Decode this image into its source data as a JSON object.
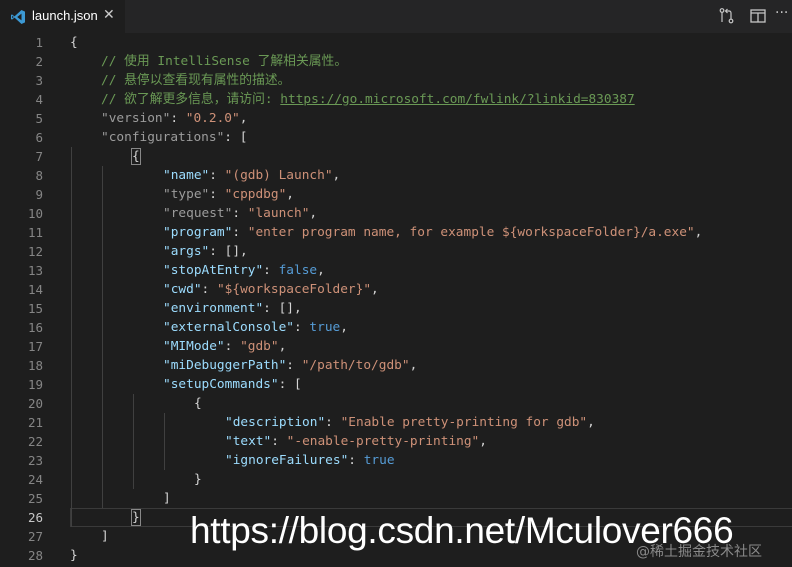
{
  "tab": {
    "label": "launch.json",
    "close_glyph": "✕"
  },
  "actions": [
    {
      "name": "open-changes-icon"
    },
    {
      "name": "split-editor-icon"
    },
    {
      "name": "more-actions-icon",
      "glyph": "···"
    }
  ],
  "current_line": 26,
  "lines": [
    {
      "n": "1",
      "ind": 0,
      "t": [
        [
          "p",
          "{"
        ]
      ]
    },
    {
      "n": "2",
      "ind": 1,
      "t": [
        [
          "c",
          "// 使用 IntelliSense 了解相关属性。"
        ]
      ]
    },
    {
      "n": "3",
      "ind": 1,
      "t": [
        [
          "c",
          "// 悬停以查看现有属性的描述。"
        ]
      ]
    },
    {
      "n": "4",
      "ind": 1,
      "t": [
        [
          "c",
          "// 欲了解更多信息，请访问: "
        ],
        [
          "u",
          "https://go.microsoft.com/fwlink/?linkid=830387"
        ]
      ]
    },
    {
      "n": "5",
      "ind": 1,
      "t": [
        [
          "kd",
          "\"version\""
        ],
        [
          "p",
          ": "
        ],
        [
          "s",
          "\"0.2.0\""
        ],
        [
          "p",
          ","
        ]
      ]
    },
    {
      "n": "6",
      "ind": 1,
      "t": [
        [
          "kd",
          "\"configurations\""
        ],
        [
          "p",
          ": ["
        ]
      ]
    },
    {
      "n": "7",
      "ind": 2,
      "t": [
        [
          "bx",
          "{"
        ]
      ]
    },
    {
      "n": "8",
      "ind": 3,
      "t": [
        [
          "k",
          "\"name\""
        ],
        [
          "p",
          ": "
        ],
        [
          "s",
          "\"(gdb) Launch\""
        ],
        [
          "p",
          ","
        ]
      ]
    },
    {
      "n": "9",
      "ind": 3,
      "t": [
        [
          "kd",
          "\"type\""
        ],
        [
          "p",
          ": "
        ],
        [
          "s",
          "\"cppdbg\""
        ],
        [
          "p",
          ","
        ]
      ]
    },
    {
      "n": "10",
      "ind": 3,
      "t": [
        [
          "kd",
          "\"request\""
        ],
        [
          "p",
          ": "
        ],
        [
          "s",
          "\"launch\""
        ],
        [
          "p",
          ","
        ]
      ]
    },
    {
      "n": "11",
      "ind": 3,
      "t": [
        [
          "k",
          "\"program\""
        ],
        [
          "p",
          ": "
        ],
        [
          "s",
          "\"enter program name, for example ${workspaceFolder}/a.exe\""
        ],
        [
          "p",
          ","
        ]
      ]
    },
    {
      "n": "12",
      "ind": 3,
      "t": [
        [
          "k",
          "\"args\""
        ],
        [
          "p",
          ": [],"
        ]
      ]
    },
    {
      "n": "13",
      "ind": 3,
      "t": [
        [
          "k",
          "\"stopAtEntry\""
        ],
        [
          "p",
          ": "
        ],
        [
          "b",
          "false"
        ],
        [
          "p",
          ","
        ]
      ]
    },
    {
      "n": "14",
      "ind": 3,
      "t": [
        [
          "k",
          "\"cwd\""
        ],
        [
          "p",
          ": "
        ],
        [
          "s",
          "\"${workspaceFolder}\""
        ],
        [
          "p",
          ","
        ]
      ]
    },
    {
      "n": "15",
      "ind": 3,
      "t": [
        [
          "k",
          "\"environment\""
        ],
        [
          "p",
          ": [],"
        ]
      ]
    },
    {
      "n": "16",
      "ind": 3,
      "t": [
        [
          "k",
          "\"externalConsole\""
        ],
        [
          "p",
          ": "
        ],
        [
          "b",
          "true"
        ],
        [
          "p",
          ","
        ]
      ]
    },
    {
      "n": "17",
      "ind": 3,
      "t": [
        [
          "k",
          "\"MIMode\""
        ],
        [
          "p",
          ": "
        ],
        [
          "s",
          "\"gdb\""
        ],
        [
          "p",
          ","
        ]
      ]
    },
    {
      "n": "18",
      "ind": 3,
      "t": [
        [
          "k",
          "\"miDebuggerPath\""
        ],
        [
          "p",
          ": "
        ],
        [
          "s",
          "\"/path/to/gdb\""
        ],
        [
          "p",
          ","
        ]
      ]
    },
    {
      "n": "19",
      "ind": 3,
      "t": [
        [
          "k",
          "\"setupCommands\""
        ],
        [
          "p",
          ": ["
        ]
      ]
    },
    {
      "n": "20",
      "ind": 4,
      "t": [
        [
          "p",
          "{"
        ]
      ]
    },
    {
      "n": "21",
      "ind": 5,
      "t": [
        [
          "k",
          "\"description\""
        ],
        [
          "p",
          ": "
        ],
        [
          "s",
          "\"Enable pretty-printing for gdb\""
        ],
        [
          "p",
          ","
        ]
      ]
    },
    {
      "n": "22",
      "ind": 5,
      "t": [
        [
          "k",
          "\"text\""
        ],
        [
          "p",
          ": "
        ],
        [
          "s",
          "\"-enable-pretty-printing\""
        ],
        [
          "p",
          ","
        ]
      ]
    },
    {
      "n": "23",
      "ind": 5,
      "t": [
        [
          "k",
          "\"ignoreFailures\""
        ],
        [
          "p",
          ": "
        ],
        [
          "b",
          "true"
        ]
      ]
    },
    {
      "n": "24",
      "ind": 4,
      "t": [
        [
          "p",
          "}"
        ]
      ]
    },
    {
      "n": "25",
      "ind": 3,
      "t": [
        [
          "p",
          "]"
        ]
      ]
    },
    {
      "n": "26",
      "ind": 2,
      "t": [
        [
          "bx",
          "}"
        ]
      ]
    },
    {
      "n": "27",
      "ind": 1,
      "t": [
        [
          "p",
          "]"
        ]
      ]
    },
    {
      "n": "28",
      "ind": 0,
      "t": [
        [
          "p",
          "}"
        ]
      ]
    }
  ],
  "watermark": {
    "text": "https://blog.csdn.net/Mculover666",
    "sub": "@稀土掘金技术社区"
  }
}
